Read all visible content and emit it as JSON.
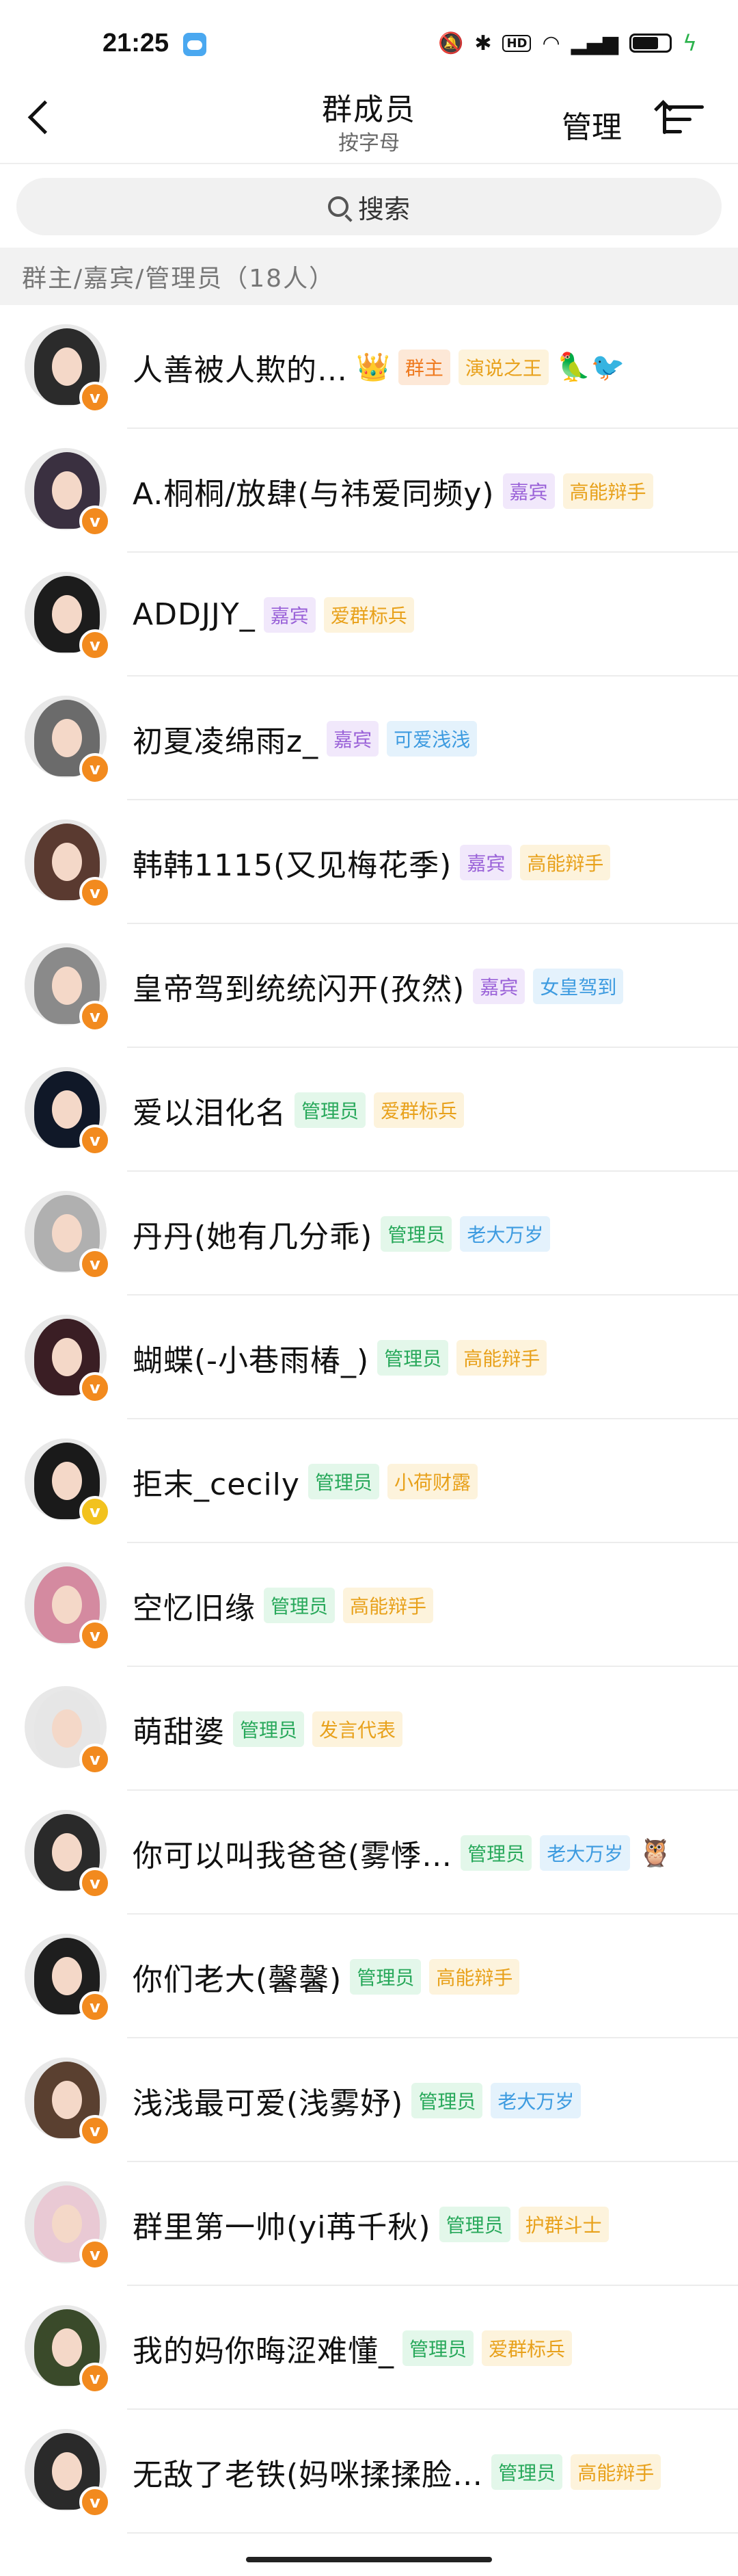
{
  "status": {
    "time": "21:25",
    "battery_level": 0.72
  },
  "nav": {
    "title": "群成员",
    "subtitle": "按字母",
    "manage_label": "管理"
  },
  "search": {
    "placeholder": "搜索"
  },
  "section_header": "群主/嘉宾/管理员（18人）",
  "members": [
    {
      "name": "人善被人欺的…",
      "tags": [
        {
          "text": "群主",
          "style": "orange"
        },
        {
          "text": "演说之王",
          "style": "yellow"
        }
      ],
      "icons": [
        "crown",
        "bird"
      ],
      "avatar_color": "#2b2b2b"
    },
    {
      "name": "A.桐桐/放肆(与祎爱同频y)",
      "tags": [
        {
          "text": "嘉宾",
          "style": "purple"
        },
        {
          "text": "高能辩手",
          "style": "yellow"
        }
      ],
      "avatar_color": "#3a3040"
    },
    {
      "name": "ADDJJY_",
      "tags": [
        {
          "text": "嘉宾",
          "style": "purple"
        },
        {
          "text": "爱群标兵",
          "style": "yellow"
        }
      ],
      "avatar_color": "#1c1c1c"
    },
    {
      "name": "初夏凌绵雨z_",
      "tags": [
        {
          "text": "嘉宾",
          "style": "purple"
        },
        {
          "text": "可爱浅浅",
          "style": "blue"
        }
      ],
      "avatar_color": "#6b6b6b"
    },
    {
      "name": "韩韩1115(又见梅花季)",
      "tags": [
        {
          "text": "嘉宾",
          "style": "purple"
        },
        {
          "text": "高能辩手",
          "style": "yellow"
        }
      ],
      "avatar_color": "#5a3a30"
    },
    {
      "name": "皇帝驾到统统闪开(孜然)",
      "tags": [
        {
          "text": "嘉宾",
          "style": "purple"
        },
        {
          "text": "女皇驾到",
          "style": "blue"
        }
      ],
      "avatar_color": "#8a8a8a"
    },
    {
      "name": "爱以泪化名",
      "tags": [
        {
          "text": "管理员",
          "style": "green"
        },
        {
          "text": "爱群标兵",
          "style": "yellow"
        }
      ],
      "avatar_color": "#101828"
    },
    {
      "name": "丹丹(她有几分乖)",
      "tags": [
        {
          "text": "管理员",
          "style": "green"
        },
        {
          "text": "老大万岁",
          "style": "blue"
        }
      ],
      "avatar_color": "#b0b0b0"
    },
    {
      "name": "蝴蝶(-小巷雨椿_)",
      "tags": [
        {
          "text": "管理员",
          "style": "green"
        },
        {
          "text": "高能辩手",
          "style": "yellow"
        }
      ],
      "avatar_color": "#3a1e24"
    },
    {
      "name": "拒末_cecily",
      "tags": [
        {
          "text": "管理员",
          "style": "green"
        },
        {
          "text": "小荷财露",
          "style": "yellow"
        }
      ],
      "avatar_color": "#1a1a1a",
      "badge": "gold"
    },
    {
      "name": "空忆旧缘",
      "tags": [
        {
          "text": "管理员",
          "style": "green"
        },
        {
          "text": "高能辩手",
          "style": "yellow"
        }
      ],
      "avatar_color": "#d48aa0"
    },
    {
      "name": "萌甜婆",
      "tags": [
        {
          "text": "管理员",
          "style": "green"
        },
        {
          "text": "发言代表",
          "style": "yellow"
        }
      ],
      "avatar_color": "#e6e6e6"
    },
    {
      "name": "你可以叫我爸爸(雾悸…",
      "tags": [
        {
          "text": "管理员",
          "style": "green"
        },
        {
          "text": "老大万岁",
          "style": "blue"
        }
      ],
      "icons": [
        "owl"
      ],
      "avatar_color": "#2a2a2a"
    },
    {
      "name": "你们老大(馨馨)",
      "tags": [
        {
          "text": "管理员",
          "style": "green"
        },
        {
          "text": "高能辩手",
          "style": "yellow"
        }
      ],
      "avatar_color": "#1e1e1e"
    },
    {
      "name": "浅浅最可爱(浅雾妤)",
      "tags": [
        {
          "text": "管理员",
          "style": "green"
        },
        {
          "text": "老大万岁",
          "style": "blue"
        }
      ],
      "avatar_color": "#5a4030"
    },
    {
      "name": "群里第一帅(yi苒千秋)",
      "tags": [
        {
          "text": "管理员",
          "style": "green"
        },
        {
          "text": "护群斗士",
          "style": "yellow"
        }
      ],
      "avatar_color": "#e9c9d4"
    },
    {
      "name": "我的妈你晦涩难懂_",
      "tags": [
        {
          "text": "管理员",
          "style": "green"
        },
        {
          "text": "爱群标兵",
          "style": "yellow"
        }
      ],
      "avatar_color": "#3a4a2a"
    },
    {
      "name": "无敌了老铁(妈咪揉揉脸…",
      "tags": [
        {
          "text": "管理员",
          "style": "green"
        },
        {
          "text": "高能辩手",
          "style": "yellow"
        }
      ],
      "avatar_color": "#2a2a2a"
    }
  ]
}
